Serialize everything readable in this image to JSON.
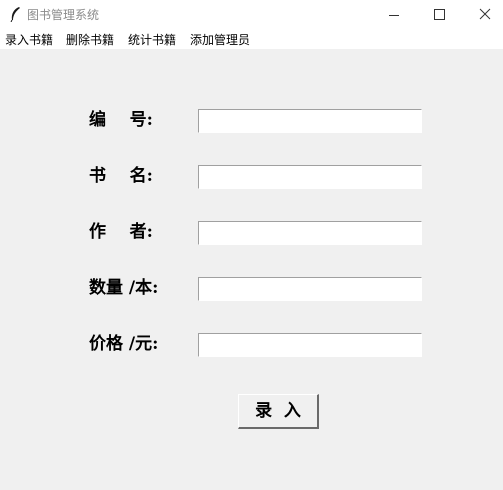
{
  "window": {
    "title": "图书管理系统",
    "icon": "feather-icon",
    "controls": [
      "minimize-icon",
      "maximize-icon",
      "close-icon"
    ]
  },
  "menu": {
    "items": [
      "录入书籍",
      "删除书籍",
      "统计书籍",
      "添加管理员"
    ]
  },
  "form": {
    "fields": [
      {
        "label": "编    号:",
        "value": ""
      },
      {
        "label": "书    名:",
        "value": ""
      },
      {
        "label": "作    者:",
        "value": ""
      },
      {
        "label": "数量 /本:",
        "value": ""
      },
      {
        "label": "价格 /元:",
        "value": ""
      }
    ],
    "submit_label": "录  入"
  }
}
